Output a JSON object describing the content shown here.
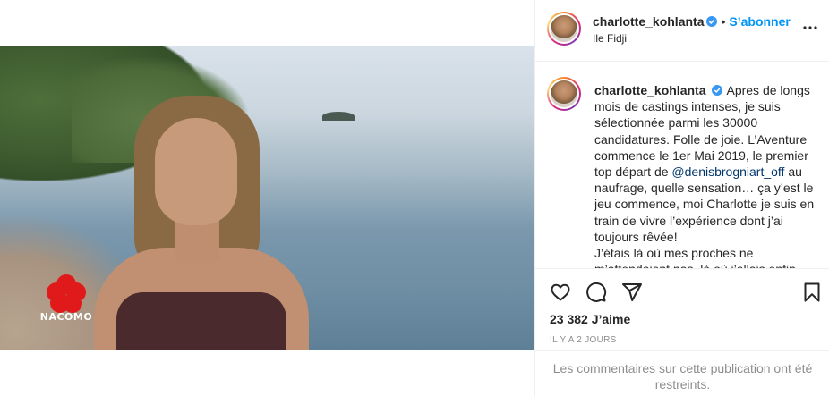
{
  "post": {
    "username": "charlotte_kohlanta",
    "follow_label": "S’abonner",
    "location": "Ile Fidji",
    "caption_before_mention": "Apres de longs mois de castings intenses, je suis sélectionnée parmi les 30000 candidatures. Folle de joie. L’Aventure commence le 1er Mai 2019, le premier top départ de ",
    "mention": "@denisbrogniart_off",
    "caption_after_mention": " au naufrage, quelle sensation… ça y’est le jeu commence, moi Charlotte je suis en train de vivre l’expérience dont j’ai toujours rêvée!",
    "caption_line2": "J’étais là où mes proches ne m’attendaient pas, là où j’allais enfin",
    "likes": "23 382 J’aime",
    "time_ago": "IL Y A 2 JOURS",
    "comments_restricted": "Les commentaires sur cette publication ont été restreints."
  },
  "media": {
    "watermark_text": "NACOMO"
  },
  "colors": {
    "accent": "#0095f6",
    "verified": "#3897f0",
    "text": "#262626",
    "muted": "#8e8e8e",
    "mention": "#00376b",
    "logo_red": "#e01a1a"
  },
  "icons": {
    "verified": "verified-badge-icon",
    "more": "more-options-icon",
    "like": "heart-icon",
    "comment": "comment-bubble-icon",
    "share": "paper-plane-icon",
    "save": "bookmark-icon"
  }
}
